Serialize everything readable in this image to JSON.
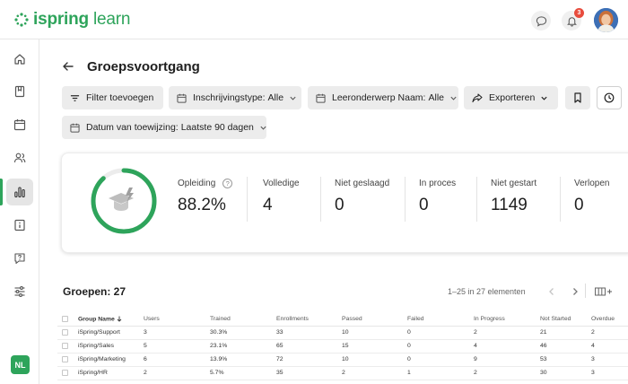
{
  "brand": {
    "name_bold": "ispring",
    "name_light": " learn",
    "color": "#2ea45b"
  },
  "header": {
    "notifications_count": "3"
  },
  "sidebar": {
    "items": [
      "home-icon",
      "book-icon",
      "calendar-icon",
      "users-icon",
      "reports-icon",
      "info-icon",
      "help-icon",
      "settings-icon"
    ],
    "active": "reports-icon",
    "user_initials": "NL"
  },
  "page": {
    "title": "Groepsvoortgang"
  },
  "filters": {
    "add_filter": "Filter toevoegen",
    "enrollment_type_label": "Inschrijvingstype:",
    "enrollment_type_value": "Alle",
    "topic_label": "Leeronderwerp Naam:",
    "topic_value": "Alle",
    "export": "Exporteren",
    "assign_date_label": "Datum van toewijzing:",
    "assign_date_value": "Laatste 90 dagen"
  },
  "stats": {
    "progress_fraction": 0.882,
    "training_label": "Opleiding",
    "training_value": "88.2%",
    "completed_label": "Volledige",
    "completed_value": "4",
    "failed_label": "Niet geslaagd",
    "failed_value": "0",
    "in_progress_label": "In proces",
    "in_progress_value": "0",
    "not_started_label": "Niet gestart",
    "not_started_value": "1149",
    "expired_label": "Verlopen",
    "expired_value": "0"
  },
  "groups": {
    "title": "Groepen: 27",
    "pagination": "1–25 in 27 elementen",
    "columns": [
      "Group Name",
      "Users",
      "Trained",
      "Enrollments",
      "Passed",
      "Failed",
      "In Progress",
      "Not Started",
      "Overdue"
    ],
    "rows": [
      [
        "iSpring/Support",
        "3",
        "30.3%",
        "33",
        "10",
        "0",
        "2",
        "21",
        "2"
      ],
      [
        "iSpring/Sales",
        "5",
        "23.1%",
        "65",
        "15",
        "0",
        "4",
        "46",
        "4"
      ],
      [
        "iSpring/Marketing",
        "6",
        "13.9%",
        "72",
        "10",
        "0",
        "9",
        "53",
        "3"
      ],
      [
        "iSpring/HR",
        "2",
        "5.7%",
        "35",
        "2",
        "1",
        "2",
        "30",
        "3"
      ]
    ]
  }
}
